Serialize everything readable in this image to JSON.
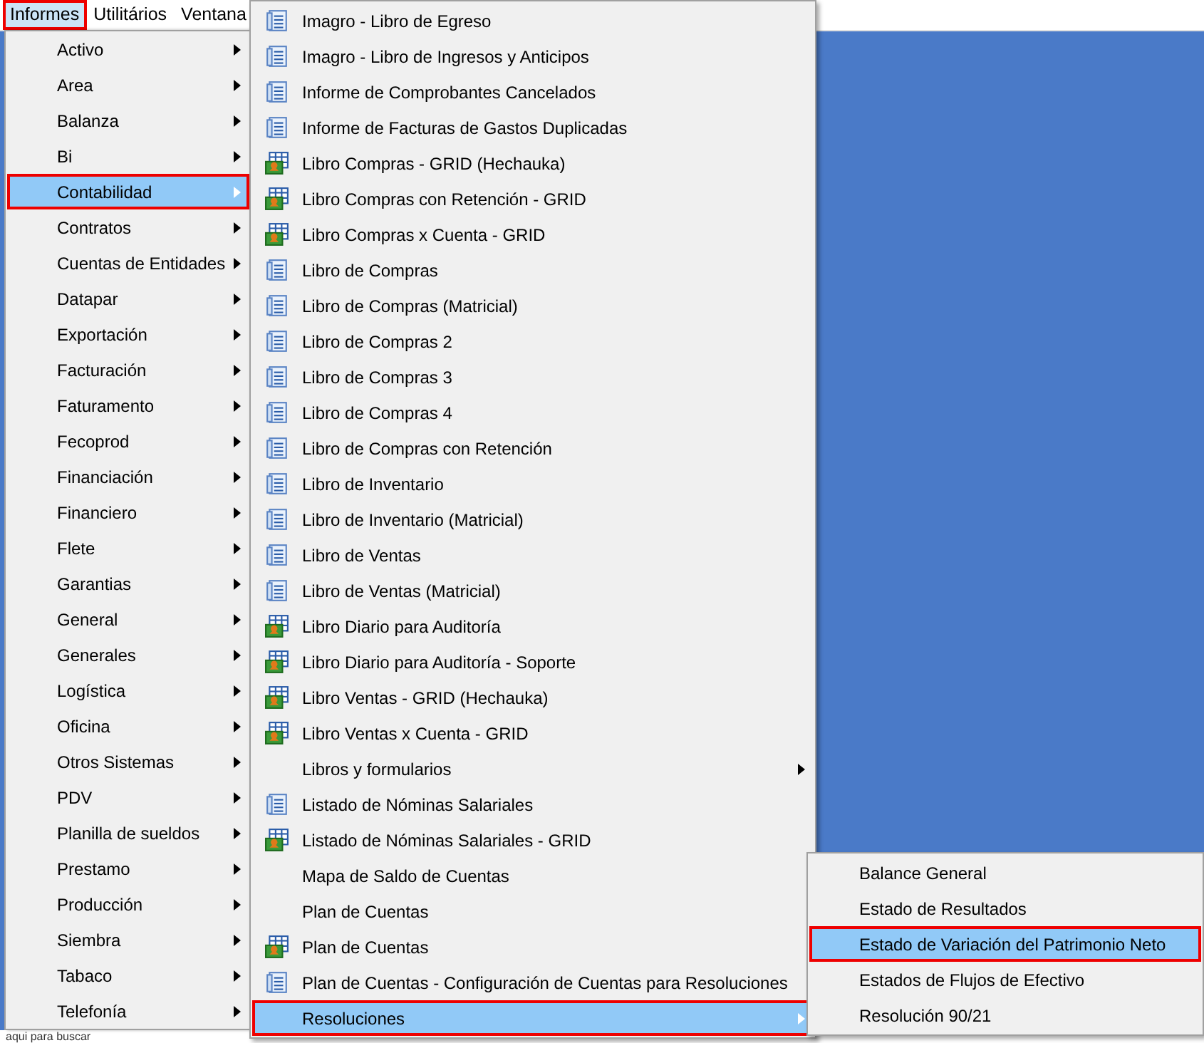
{
  "menu_bar": [
    {
      "label": "Informes",
      "selected": true
    },
    {
      "label": "Utilitários",
      "selected": false
    },
    {
      "label": "Ventana",
      "selected": false
    }
  ],
  "search_hint": "aqui para buscar",
  "menus": [
    {
      "items": [
        {
          "label": "Activo",
          "submenu": true,
          "selected": false
        },
        {
          "label": "Area",
          "submenu": true,
          "selected": false
        },
        {
          "label": "Balanza",
          "submenu": true,
          "selected": false
        },
        {
          "label": "Bi",
          "submenu": true,
          "selected": false
        },
        {
          "label": "Contabilidad",
          "submenu": true,
          "selected": true
        },
        {
          "label": "Contratos",
          "submenu": true,
          "selected": false
        },
        {
          "label": "Cuentas de Entidades",
          "submenu": true,
          "selected": false
        },
        {
          "label": "Datapar",
          "submenu": true,
          "selected": false
        },
        {
          "label": "Exportación",
          "submenu": true,
          "selected": false
        },
        {
          "label": "Facturación",
          "submenu": true,
          "selected": false
        },
        {
          "label": "Faturamento",
          "submenu": true,
          "selected": false
        },
        {
          "label": "Fecoprod",
          "submenu": true,
          "selected": false
        },
        {
          "label": "Financiación",
          "submenu": true,
          "selected": false
        },
        {
          "label": "Financiero",
          "submenu": true,
          "selected": false
        },
        {
          "label": "Flete",
          "submenu": true,
          "selected": false
        },
        {
          "label": "Garantias",
          "submenu": true,
          "selected": false
        },
        {
          "label": "General",
          "submenu": true,
          "selected": false
        },
        {
          "label": "Generales",
          "submenu": true,
          "selected": false
        },
        {
          "label": "Logística",
          "submenu": true,
          "selected": false
        },
        {
          "label": "Oficina",
          "submenu": true,
          "selected": false
        },
        {
          "label": "Otros Sistemas",
          "submenu": true,
          "selected": false
        },
        {
          "label": "PDV",
          "submenu": true,
          "selected": false
        },
        {
          "label": "Planilla de sueldos",
          "submenu": true,
          "selected": false
        },
        {
          "label": "Prestamo",
          "submenu": true,
          "selected": false
        },
        {
          "label": "Producción",
          "submenu": true,
          "selected": false
        },
        {
          "label": "Siembra",
          "submenu": true,
          "selected": false
        },
        {
          "label": "Tabaco",
          "submenu": true,
          "selected": false
        },
        {
          "label": "Telefonía",
          "submenu": true,
          "selected": false
        }
      ]
    },
    {
      "items": [
        {
          "label": "Imagro - Libro de Egreso",
          "kind": "report",
          "submenu": false,
          "selected": false
        },
        {
          "label": "Imagro - Libro de Ingresos y Anticipos",
          "kind": "report",
          "submenu": false,
          "selected": false
        },
        {
          "label": "Informe de Comprobantes Cancelados",
          "kind": "report",
          "submenu": false,
          "selected": false
        },
        {
          "label": "Informe de Facturas de Gastos Duplicadas",
          "kind": "report",
          "submenu": false,
          "selected": false
        },
        {
          "label": "Libro Compras - GRID (Hechauka)",
          "kind": "grid",
          "submenu": false,
          "selected": false
        },
        {
          "label": "Libro Compras con Retención - GRID",
          "kind": "grid",
          "submenu": false,
          "selected": false
        },
        {
          "label": "Libro Compras x Cuenta - GRID",
          "kind": "grid",
          "submenu": false,
          "selected": false
        },
        {
          "label": "Libro de Compras",
          "kind": "report",
          "submenu": false,
          "selected": false
        },
        {
          "label": "Libro de Compras (Matricial)",
          "kind": "report",
          "submenu": false,
          "selected": false
        },
        {
          "label": "Libro de Compras 2",
          "kind": "report",
          "submenu": false,
          "selected": false
        },
        {
          "label": "Libro de Compras 3",
          "kind": "report",
          "submenu": false,
          "selected": false
        },
        {
          "label": "Libro de Compras 4",
          "kind": "report",
          "submenu": false,
          "selected": false
        },
        {
          "label": "Libro de Compras con Retención",
          "kind": "report",
          "submenu": false,
          "selected": false
        },
        {
          "label": "Libro de Inventario",
          "kind": "report",
          "submenu": false,
          "selected": false
        },
        {
          "label": "Libro de Inventario (Matricial)",
          "kind": "report",
          "submenu": false,
          "selected": false
        },
        {
          "label": "Libro de Ventas",
          "kind": "report",
          "submenu": false,
          "selected": false
        },
        {
          "label": "Libro de Ventas (Matricial)",
          "kind": "report",
          "submenu": false,
          "selected": false
        },
        {
          "label": "Libro Diario para Auditoría",
          "kind": "grid",
          "submenu": false,
          "selected": false
        },
        {
          "label": "Libro Diario para Auditoría - Soporte",
          "kind": "grid",
          "submenu": false,
          "selected": false
        },
        {
          "label": "Libro Ventas - GRID (Hechauka)",
          "kind": "grid",
          "submenu": false,
          "selected": false
        },
        {
          "label": "Libro Ventas x Cuenta - GRID",
          "kind": "grid",
          "submenu": false,
          "selected": false
        },
        {
          "label": "Libros y formularios",
          "kind": "plain",
          "submenu": true,
          "selected": false
        },
        {
          "label": "Listado de Nóminas Salariales",
          "kind": "report",
          "submenu": false,
          "selected": false
        },
        {
          "label": "Listado de Nóminas Salariales - GRID",
          "kind": "grid",
          "submenu": false,
          "selected": false
        },
        {
          "label": "Mapa de Saldo de Cuentas",
          "kind": "plain",
          "submenu": false,
          "selected": false
        },
        {
          "label": "Plan de Cuentas",
          "kind": "plain",
          "submenu": false,
          "selected": false
        },
        {
          "label": "Plan de Cuentas",
          "kind": "grid",
          "submenu": false,
          "selected": false
        },
        {
          "label": "Plan de Cuentas - Configuración de Cuentas para Resoluciones",
          "kind": "report",
          "submenu": false,
          "selected": false
        },
        {
          "label": "Resoluciones",
          "kind": "plain",
          "submenu": true,
          "selected": true
        }
      ]
    },
    {
      "items": [
        {
          "label": "Balance General",
          "submenu": false,
          "selected": false
        },
        {
          "label": "Estado de Resultados",
          "submenu": false,
          "selected": false
        },
        {
          "label": "Estado de Variación del Patrimonio Neto",
          "submenu": false,
          "selected": true
        },
        {
          "label": "Estados de Flujos de Efectivo",
          "submenu": false,
          "selected": false
        },
        {
          "label": "Resolución 90/21",
          "submenu": false,
          "selected": false
        }
      ]
    }
  ]
}
